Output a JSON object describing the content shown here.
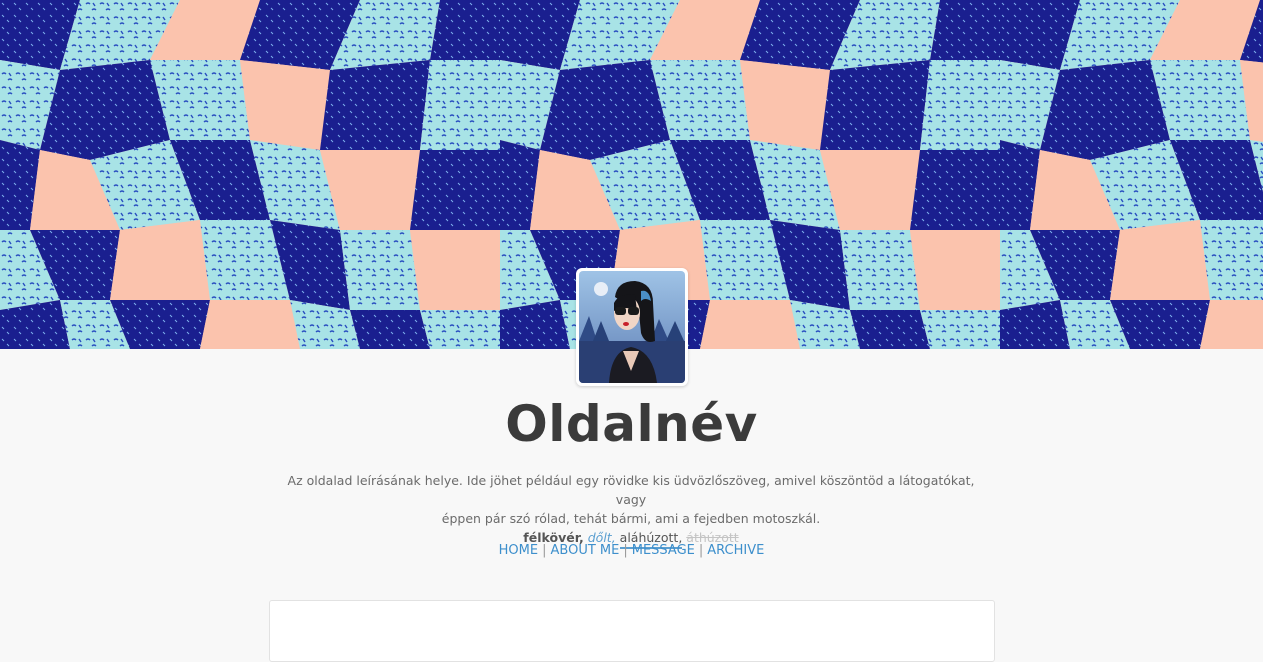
{
  "blog": {
    "title": "Oldalnév",
    "description_line1": "Az oldalad leírásának helye. Ide jöhet például egy rövidke kis üdvözlőszöveg, amivel köszöntöd a látogatókat, vagy",
    "description_line2": "éppen pár szó rólad, tehát bármi, ami a fejedben motoszkál.",
    "formatting": {
      "bold": "félkövér,",
      "italic": "dőlt,",
      "underline": "aláhúzott,",
      "strike": "áthúzott"
    }
  },
  "header": {
    "pattern_colors": {
      "peach": "#fbc3ad",
      "navy": "#1a1f8f",
      "mint": "#a8e3e6",
      "blue_dash": "#2a4fc0"
    }
  },
  "avatar": {
    "icon": "avatar-illustration"
  },
  "nav": {
    "items": [
      "HOME",
      "ABOUT ME",
      "MESSAGE",
      "ARCHIVE"
    ],
    "separator": "|",
    "link_color": "#3d8fcc"
  }
}
